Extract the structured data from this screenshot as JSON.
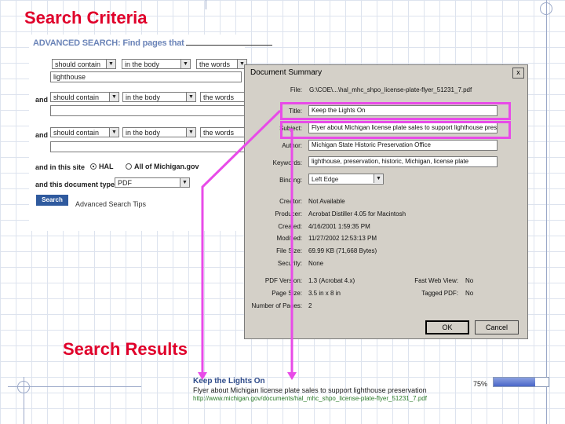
{
  "slide": {
    "title": "Search Criteria",
    "results_label": "Search Results"
  },
  "advanced_search": {
    "title_main": "ADVANCED SEARCH:",
    "title_sub": "Find pages that",
    "row1": {
      "condition": "should contain",
      "location": "in the body",
      "mode": "the words",
      "value": "lighthouse"
    },
    "row2": {
      "connector": "and",
      "condition": "should contain",
      "location": "in the body",
      "mode": "the words",
      "value": ""
    },
    "row3": {
      "connector": "and",
      "condition": "should contain",
      "location": "in the body",
      "mode": "the words",
      "value": ""
    },
    "site_label": "and in this site",
    "site_options": [
      "HAL",
      "All of Michigan.gov"
    ],
    "site_selected": "HAL",
    "type_label": "and this document type",
    "type_value": "PDF",
    "search_button": "Search",
    "tips_link": "Advanced Search Tips"
  },
  "document_summary": {
    "title": "Document Summary",
    "close": "x",
    "file_label": "File:",
    "file_value": "G:\\COE\\...\\hal_mhc_shpo_license-plate-flyer_51231_7.pdf",
    "fields": [
      {
        "label": "Title:",
        "value": "Keep the Lights On"
      },
      {
        "label": "Subject:",
        "value": "Flyer about Michigan license plate sales to support lighthouse pres"
      },
      {
        "label": "Author:",
        "value": "Michigan State Historic Preservation Office"
      },
      {
        "label": "Keywords:",
        "value": "lighthouse, preservation, historic, Michigan, license plate"
      }
    ],
    "binding_label": "Binding:",
    "binding_value": "Left Edge",
    "info": [
      {
        "label": "Creator:",
        "value": "Not Available"
      },
      {
        "label": "Producer:",
        "value": "Acrobat Distiller 4.05 for Macintosh"
      },
      {
        "label": "Created:",
        "value": "4/16/2001 1:59:35 PM"
      },
      {
        "label": "Modified:",
        "value": "11/27/2002 12:53:13 PM"
      },
      {
        "label": "File Size:",
        "value": "69.99 KB (71,668 Bytes)"
      },
      {
        "label": "Security:",
        "value": "None"
      }
    ],
    "pdf_version_label": "PDF Version:",
    "pdf_version_value": "1.3 (Acrobat 4.x)",
    "page_size_label": "Page Size:",
    "page_size_value": "3.5 in x 8 in",
    "pages_label": "Number of Pages:",
    "pages_value": "2",
    "fast_web_label": "Fast Web View:",
    "fast_web_value": "No",
    "tagged_label": "Tagged PDF:",
    "tagged_value": "No",
    "ok_button": "OK",
    "cancel_button": "Cancel"
  },
  "result": {
    "title": "Keep the Lights On",
    "description": "Flyer about Michigan license plate sales to support lighthouse preservation",
    "url": "http://www.michigan.gov/documents/hal_mhc_shpo_license-plate-flyer_51231_7.pdf",
    "relevance_text": "75%",
    "relevance": 0.75
  },
  "colors": {
    "title_red": "#e0002a",
    "highlight": "#e84be8",
    "link_blue": "#2e4b8a"
  }
}
